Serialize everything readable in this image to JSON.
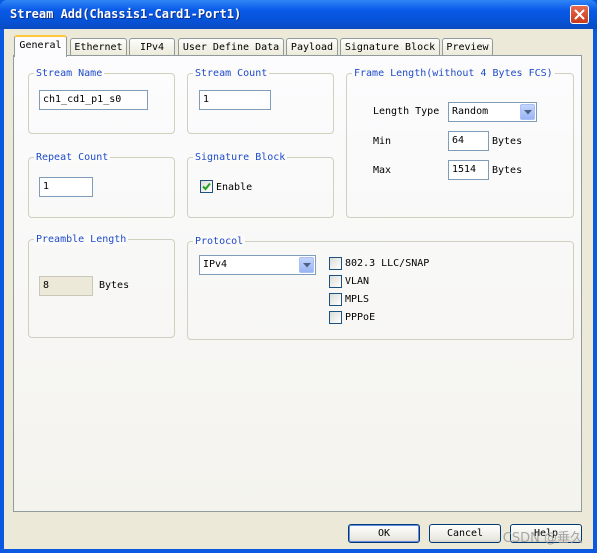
{
  "window": {
    "title": "Stream Add(Chassis1-Card1-Port1)"
  },
  "tabs": [
    {
      "label": "General",
      "active": true
    },
    {
      "label": "Ethernet"
    },
    {
      "label": "IPv4"
    },
    {
      "label": "User Define Data"
    },
    {
      "label": "Payload"
    },
    {
      "label": "Signature Block"
    },
    {
      "label": "Preview"
    }
  ],
  "stream_name": {
    "legend": "Stream Name",
    "value": "ch1_cd1_p1_s0"
  },
  "stream_count": {
    "legend": "Stream Count",
    "value": "1"
  },
  "frame_length": {
    "legend": "Frame Length(without 4 Bytes FCS)",
    "length_type_label": "Length Type",
    "length_type_value": "Random",
    "min_label": "Min",
    "min_value": "64",
    "max_label": "Max",
    "max_value": "1514",
    "unit": "Bytes"
  },
  "repeat_count": {
    "legend": "Repeat Count",
    "value": "1"
  },
  "signature_block": {
    "legend": "Signature Block",
    "enable_label": "Enable",
    "enable_checked": true
  },
  "preamble_length": {
    "legend": "Preamble Length",
    "value": "8",
    "unit": "Bytes"
  },
  "protocol": {
    "legend": "Protocol",
    "selected": "IPv4",
    "options": [
      {
        "label": "802.3 LLC/SNAP",
        "checked": false
      },
      {
        "label": "VLAN",
        "checked": false
      },
      {
        "label": "MPLS",
        "checked": false
      },
      {
        "label": "PPPoE",
        "checked": false
      }
    ]
  },
  "buttons": {
    "ok": "OK",
    "cancel": "Cancel",
    "help": "Help"
  },
  "watermark": "CSDN @垂久",
  "colors": {
    "titlebar": "#0a5ae8",
    "legend_text": "#1f4bcc",
    "dialog_bg": "#ece9d8"
  }
}
